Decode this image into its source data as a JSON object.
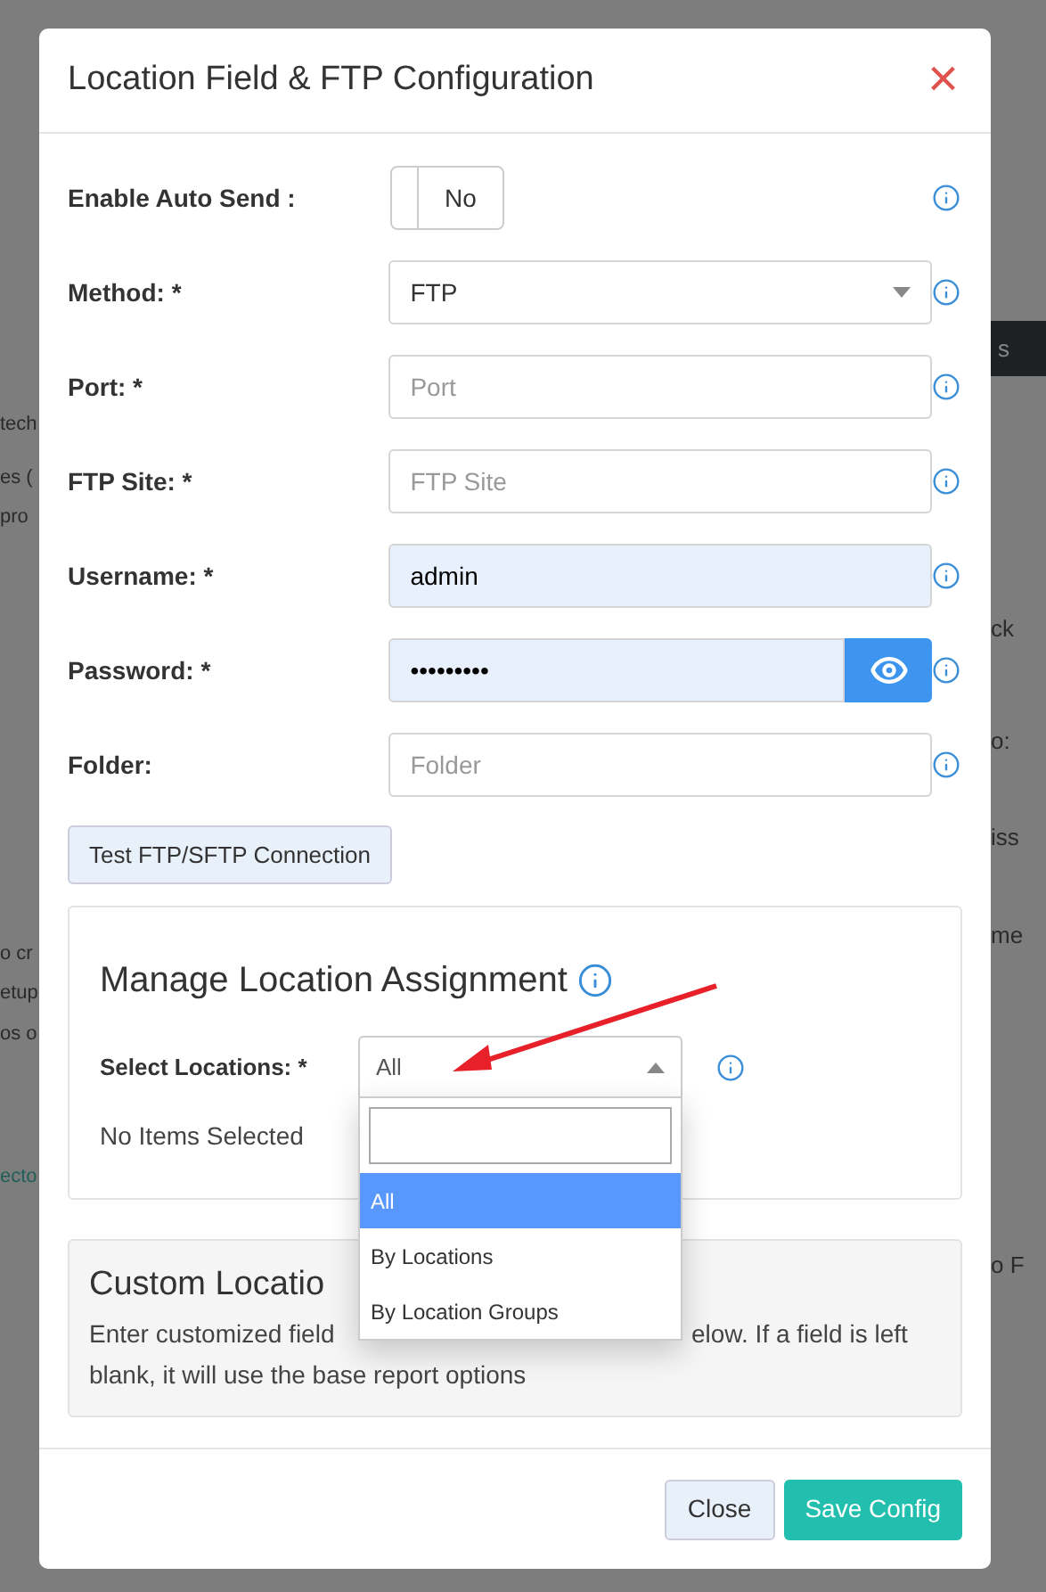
{
  "background": {
    "left_fragments": [
      "tech",
      "es (",
      "pro",
      "o cr",
      "etup",
      "os o",
      "ecto"
    ],
    "right_bar_text": "s",
    "right_fragments": [
      "ck",
      "o:",
      "iss",
      "me",
      "o F"
    ]
  },
  "modal": {
    "title": "Location Field & FTP Configuration",
    "close_icon": "×",
    "fields": [
      {
        "kind": "toggle",
        "label": "Enable Auto Send :",
        "value": "No",
        "on": false
      },
      {
        "kind": "select",
        "label": "Method: *",
        "value": "FTP"
      },
      {
        "kind": "text",
        "label": "Port: *",
        "placeholder": "Port",
        "autofilled": false
      },
      {
        "kind": "text",
        "label": "FTP Site: *",
        "placeholder": "FTP Site",
        "autofilled": false
      },
      {
        "kind": "text",
        "label": "Username: *",
        "value": "admin",
        "autofilled": true
      },
      {
        "kind": "password",
        "label": "Password: *",
        "value": "•••••••••",
        "autofilled": true
      },
      {
        "kind": "text",
        "label": "Folder:",
        "placeholder": "Folder",
        "autofilled": false
      }
    ],
    "test_button": "Test FTP/SFTP Connection",
    "location_assignment": {
      "heading": "Manage Location Assignment",
      "label": "Select Locations: *",
      "value": "All",
      "expanded": true,
      "empty_text": "No Items Selected",
      "options": [
        {
          "label": "All",
          "selected": true
        },
        {
          "label": "By Locations",
          "selected": false
        },
        {
          "label": "By Location Groups",
          "selected": false
        }
      ]
    },
    "custom_location": {
      "heading": "Custom Locatio",
      "description_left": "Enter customized field",
      "description_right": "elow. If a field is left",
      "description_line_2": "blank, it will use the base report options"
    },
    "buttons": [
      {
        "kind": "secondary",
        "label": "Close"
      },
      {
        "kind": "primary",
        "label": "Save Config"
      }
    ]
  }
}
